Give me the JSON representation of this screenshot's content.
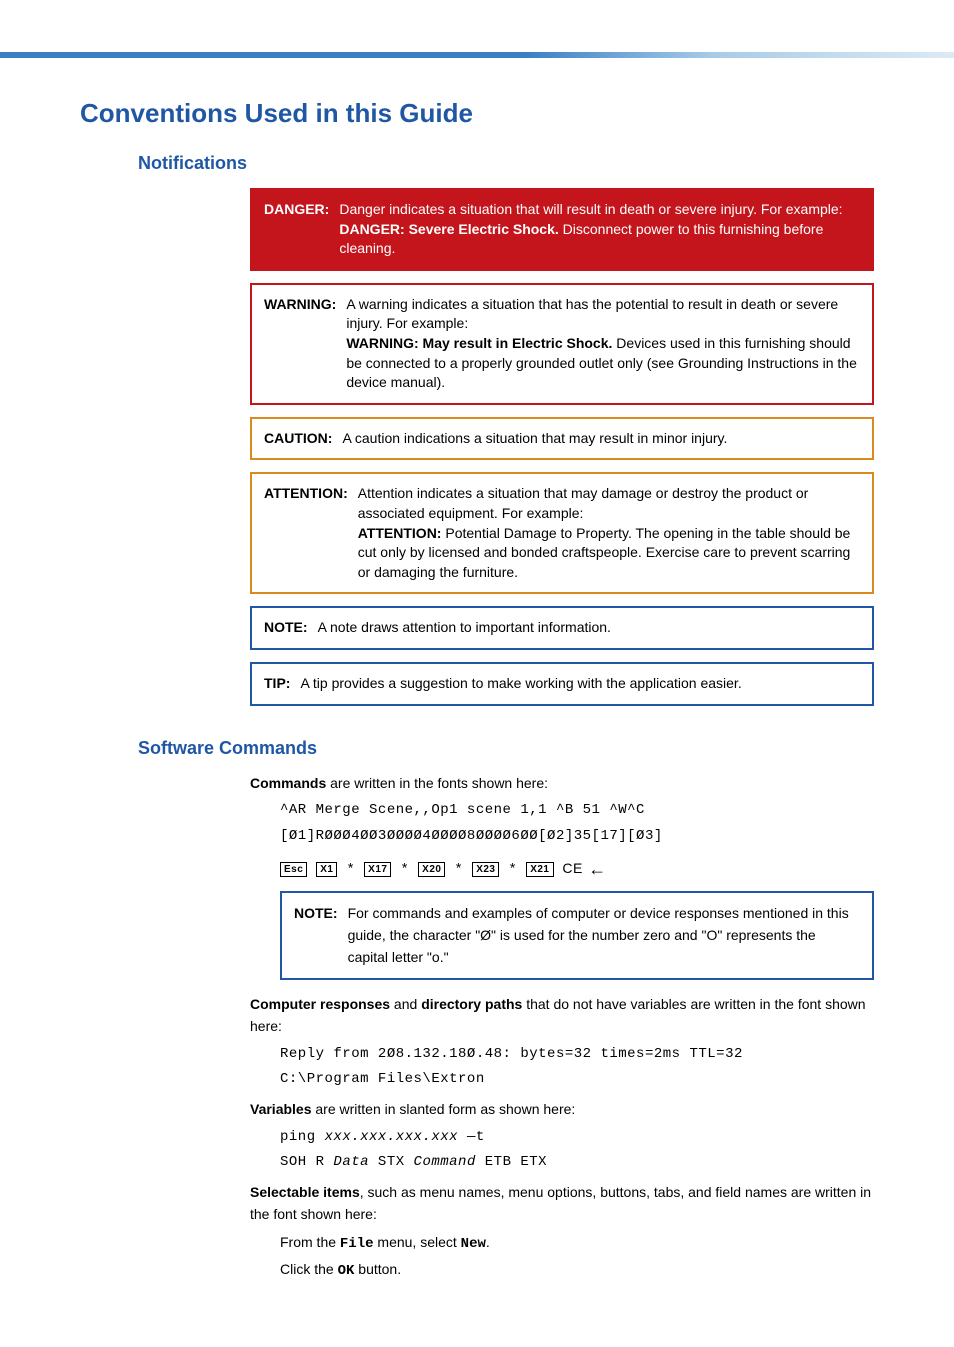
{
  "page": {
    "title": "Conventions Used in this Guide"
  },
  "notifications": {
    "heading": "Notifications",
    "danger": {
      "label": "DANGER:",
      "text1": "Danger indicates a situation that will result in death or severe injury. For example:",
      "emph_label": "DANGER",
      "emph_rest": ": Severe Electric Shock.",
      "text2": " Disconnect power to this furnishing before cleaning."
    },
    "warning": {
      "label": "WARNING:",
      "text1": "A warning indicates a situation that has the potential to result in death or severe injury. For example:",
      "emph_label": "WARNING:",
      "emph_rest": " May result in Electric Shock.",
      "text2": " Devices used in this furnishing should be connected to a properly grounded outlet only (see Grounding Instructions in the device manual)."
    },
    "caution": {
      "label": "CAUTION:",
      "text": "A caution indications a situation that may result in minor injury."
    },
    "attention": {
      "label": "ATTENTION:",
      "text1": "Attention indicates a situation that may damage or destroy the product or associated equipment. For example:",
      "emph_label": "ATTENTION:",
      "text2": " Potential Damage to Property. The opening in the table should be cut only by licensed and bonded craftspeople. Exercise care to prevent scarring or damaging the furniture."
    },
    "note": {
      "label": "NOTE:",
      "text": "A note draws attention to important information."
    },
    "tip": {
      "label": "TIP:",
      "text": "A tip provides a suggestion to make working with the application easier."
    }
  },
  "software": {
    "heading": "Software Commands",
    "commands_intro_bold": "Commands",
    "commands_intro_rest": " are written in the fonts shown here:",
    "cmd_line1": "^AR Merge Scene,,Op1 scene 1,1 ^B 51 ^W^C",
    "cmd_line2": "[Ø1]RØØØ4ØØ3ØØØØ4ØØØØ8ØØØØ6ØØ[Ø2]35[17][Ø3]",
    "keys": {
      "esc": "Esc",
      "x1": "X1",
      "x17": "X17",
      "x20": "X20",
      "x23": "X23",
      "x21": "X21",
      "star": "*",
      "ce": "CE"
    },
    "inner_note": {
      "label": "NOTE:",
      "text": "For commands and examples of computer or device responses mentioned in this guide, the character \"Ø\" is used for the number zero and \"O\" represents the capital letter \"o.\""
    },
    "resp_intro_b1": "Computer responses",
    "resp_intro_mid": " and ",
    "resp_intro_b2": "directory paths",
    "resp_intro_rest": " that do not have variables are written in the font shown here:",
    "resp_line1": "Reply from 2Ø8.132.18Ø.48: bytes=32 times=2ms TTL=32",
    "resp_line2": "C:\\Program Files\\Extron",
    "vars_intro_bold": "Variables",
    "vars_intro_rest": " are written in slanted form as shown here:",
    "vars_line1_a": "ping ",
    "vars_line1_b": "xxx.xxx.xxx.xxx",
    "vars_line1_c": " —t",
    "vars_line2_a": "SOH R ",
    "vars_line2_b": "Data",
    "vars_line2_c": " STX ",
    "vars_line2_d": "Command",
    "vars_line2_e": " ETB ETX",
    "sel_intro_bold": "Selectable items",
    "sel_intro_rest": ", such as menu names, menu options, buttons, tabs, and field names are written in the font shown here:",
    "sel_line1_a": "From the ",
    "sel_line1_b": "File",
    "sel_line1_c": " menu, select ",
    "sel_line1_d": "New",
    "sel_line1_e": ".",
    "sel_line2_a": "Click the ",
    "sel_line2_b": "OK",
    "sel_line2_c": " button."
  }
}
